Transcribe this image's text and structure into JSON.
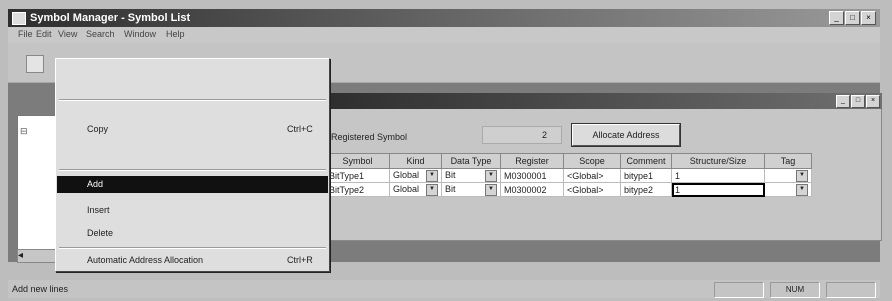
{
  "window": {
    "title": "Symbol Manager - Symbol List",
    "buttons": {
      "minimize": "_",
      "maximize": "□",
      "close": "×"
    }
  },
  "menubar": {
    "items": [
      "File",
      "Edit",
      "View",
      "Search",
      "Window",
      "Help"
    ]
  },
  "edit_menu": {
    "items": [
      {
        "label": "",
        "shortcut": "",
        "state": "disabled"
      },
      {
        "label": "Copy",
        "shortcut": "Ctrl+C",
        "state": "enabled"
      },
      {
        "label": "Add",
        "shortcut": "",
        "state": "selected"
      },
      {
        "label": "Insert",
        "shortcut": "",
        "state": "enabled"
      },
      {
        "label": "Delete",
        "shortcut": "",
        "state": "enabled"
      },
      {
        "label": "Automatic Address Allocation",
        "shortcut": "Ctrl+R",
        "state": "enabled"
      }
    ]
  },
  "tree": {
    "scroll_left": "◂"
  },
  "child_window": {
    "registered_label": "Registered Symbol",
    "registered_count": "2",
    "allocate_button": "Allocate Address",
    "columns": [
      "Symbol",
      "Kind",
      "Data Type",
      "Register",
      "Scope",
      "Comment",
      "Structure/Size",
      "Tag"
    ],
    "rows": [
      {
        "symbol": "BitType1",
        "kind": "Global",
        "data_type": "Bit",
        "register": "M0300001",
        "scope": "<Global>",
        "comment": "bitype1",
        "size": "1",
        "tag": ""
      },
      {
        "symbol": "BitType2",
        "kind": "Global",
        "data_type": "Bit",
        "register": "M0300002",
        "scope": "<Global>",
        "comment": "bitype2",
        "size": "1",
        "tag": ""
      }
    ]
  },
  "status": {
    "text": "Add new lines",
    "num": "NUM"
  }
}
